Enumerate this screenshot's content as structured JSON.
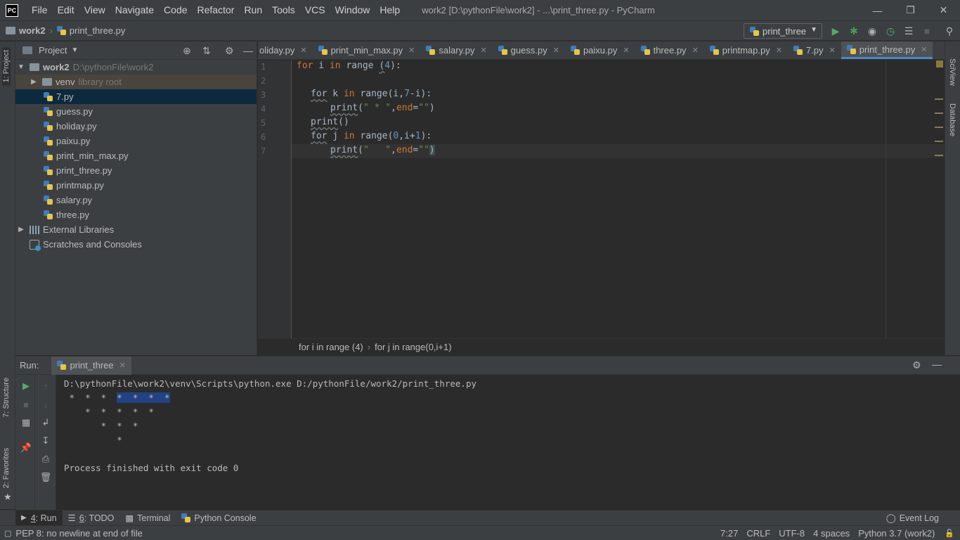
{
  "app": {
    "logo_text": "PC",
    "window_title": "work2 [D:\\pythonFile\\work2] - ...\\print_three.py - PyCharm",
    "menu": [
      "File",
      "Edit",
      "View",
      "Navigate",
      "Code",
      "Refactor",
      "Run",
      "Tools",
      "VCS",
      "Window",
      "Help"
    ]
  },
  "navbar": {
    "project": "work2",
    "file": "print_three.py",
    "run_config": "print_three"
  },
  "left_strip": {
    "project_tab": "1: Project",
    "structure_tab": "7: Structure",
    "favorites_tab": "2: Favorites"
  },
  "right_strip": {
    "sciview": "SciView",
    "database": "Database"
  },
  "project_panel": {
    "title": "Project",
    "root_name": "work2",
    "root_path": "D:\\pythonFile\\work2",
    "venv_name": "venv",
    "venv_note": "library root",
    "files": [
      "7.py",
      "guess.py",
      "holiday.py",
      "paixu.py",
      "print_min_max.py",
      "print_three.py",
      "printmap.py",
      "salary.py",
      "three.py"
    ],
    "external_libraries": "External Libraries",
    "scratches": "Scratches and Consoles"
  },
  "editor": {
    "tabs": [
      "oliday.py",
      "print_min_max.py",
      "salary.py",
      "guess.py",
      "paixu.py",
      "three.py",
      "printmap.py",
      "7.py",
      "print_three.py"
    ],
    "active_tab": "print_three.py",
    "line_numbers": [
      "1",
      "2",
      "3",
      "4",
      "5",
      "6",
      "7"
    ],
    "breadcrumb": [
      "for i in range (4)",
      "for j in range(0,i+1)"
    ]
  },
  "run_panel": {
    "label": "Run:",
    "tab": "print_three",
    "command": "D:\\pythonFile\\work2\\venv\\Scripts\\python.exe D:/pythonFile/work2/print_three.py",
    "output_lines": [
      " *  *  *  ",
      "    *  *  *  *  *",
      "       *  *  *",
      "          *"
    ],
    "highlight": "*  *  *  *",
    "exit_message": "Process finished with exit code 0"
  },
  "bottom_tabs": [
    {
      "num": "4",
      "label": ": Run"
    },
    {
      "num": "6",
      "label": ": TODO"
    },
    {
      "num": "",
      "label": "Terminal"
    },
    {
      "num": "",
      "label": "Python Console"
    }
  ],
  "event_log": "Event Log",
  "status": {
    "message": "PEP 8: no newline at end of file",
    "position": "7:27",
    "line_sep": "CRLF",
    "encoding": "UTF-8",
    "indent": "4 spaces",
    "interpreter": "Python 3.7 (work2)"
  }
}
